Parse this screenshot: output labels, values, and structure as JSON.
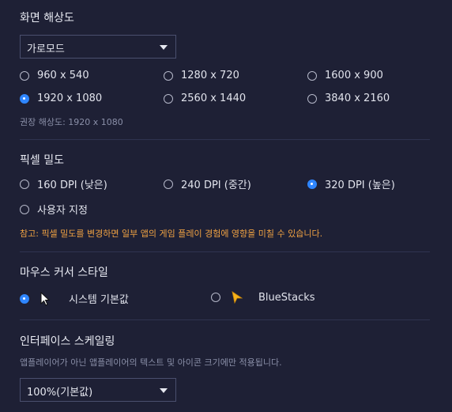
{
  "resolution": {
    "title": "화면 해상도",
    "mode_value": "가로모드",
    "options": [
      "960 x 540",
      "1280 x 720",
      "1600 x 900",
      "1920 x 1080",
      "2560 x 1440",
      "3840 x 2160"
    ],
    "selected": "1920 x 1080",
    "recommended": "권장 해상도: 1920 x 1080"
  },
  "pixel_density": {
    "title": "픽셀 밀도",
    "options": [
      "160 DPI (낮은)",
      "240 DPI (중간)",
      "320 DPI (높은)",
      "사용자 지정"
    ],
    "selected": "320 DPI (높은)",
    "warning": "참고: 픽셀 밀도를 변경하면 일부 앱의 게임 플레이 경험에 영향을 미칠 수 있습니다."
  },
  "mouse_cursor": {
    "title": "마우스 커서 스타일",
    "options": [
      "시스템 기본값",
      "BlueStacks"
    ],
    "selected": "시스템 기본값"
  },
  "interface_scaling": {
    "title": "인터페이스 스케일링",
    "description": "앱플레이어가 아닌 앱플레이어의 텍스트 및 아이콘 크기에만 적용됩니다.",
    "scale_value": "100%(기본값)"
  },
  "colors": {
    "accent": "#2f86ff",
    "warning": "#f0a243",
    "background": "#1e2035"
  }
}
